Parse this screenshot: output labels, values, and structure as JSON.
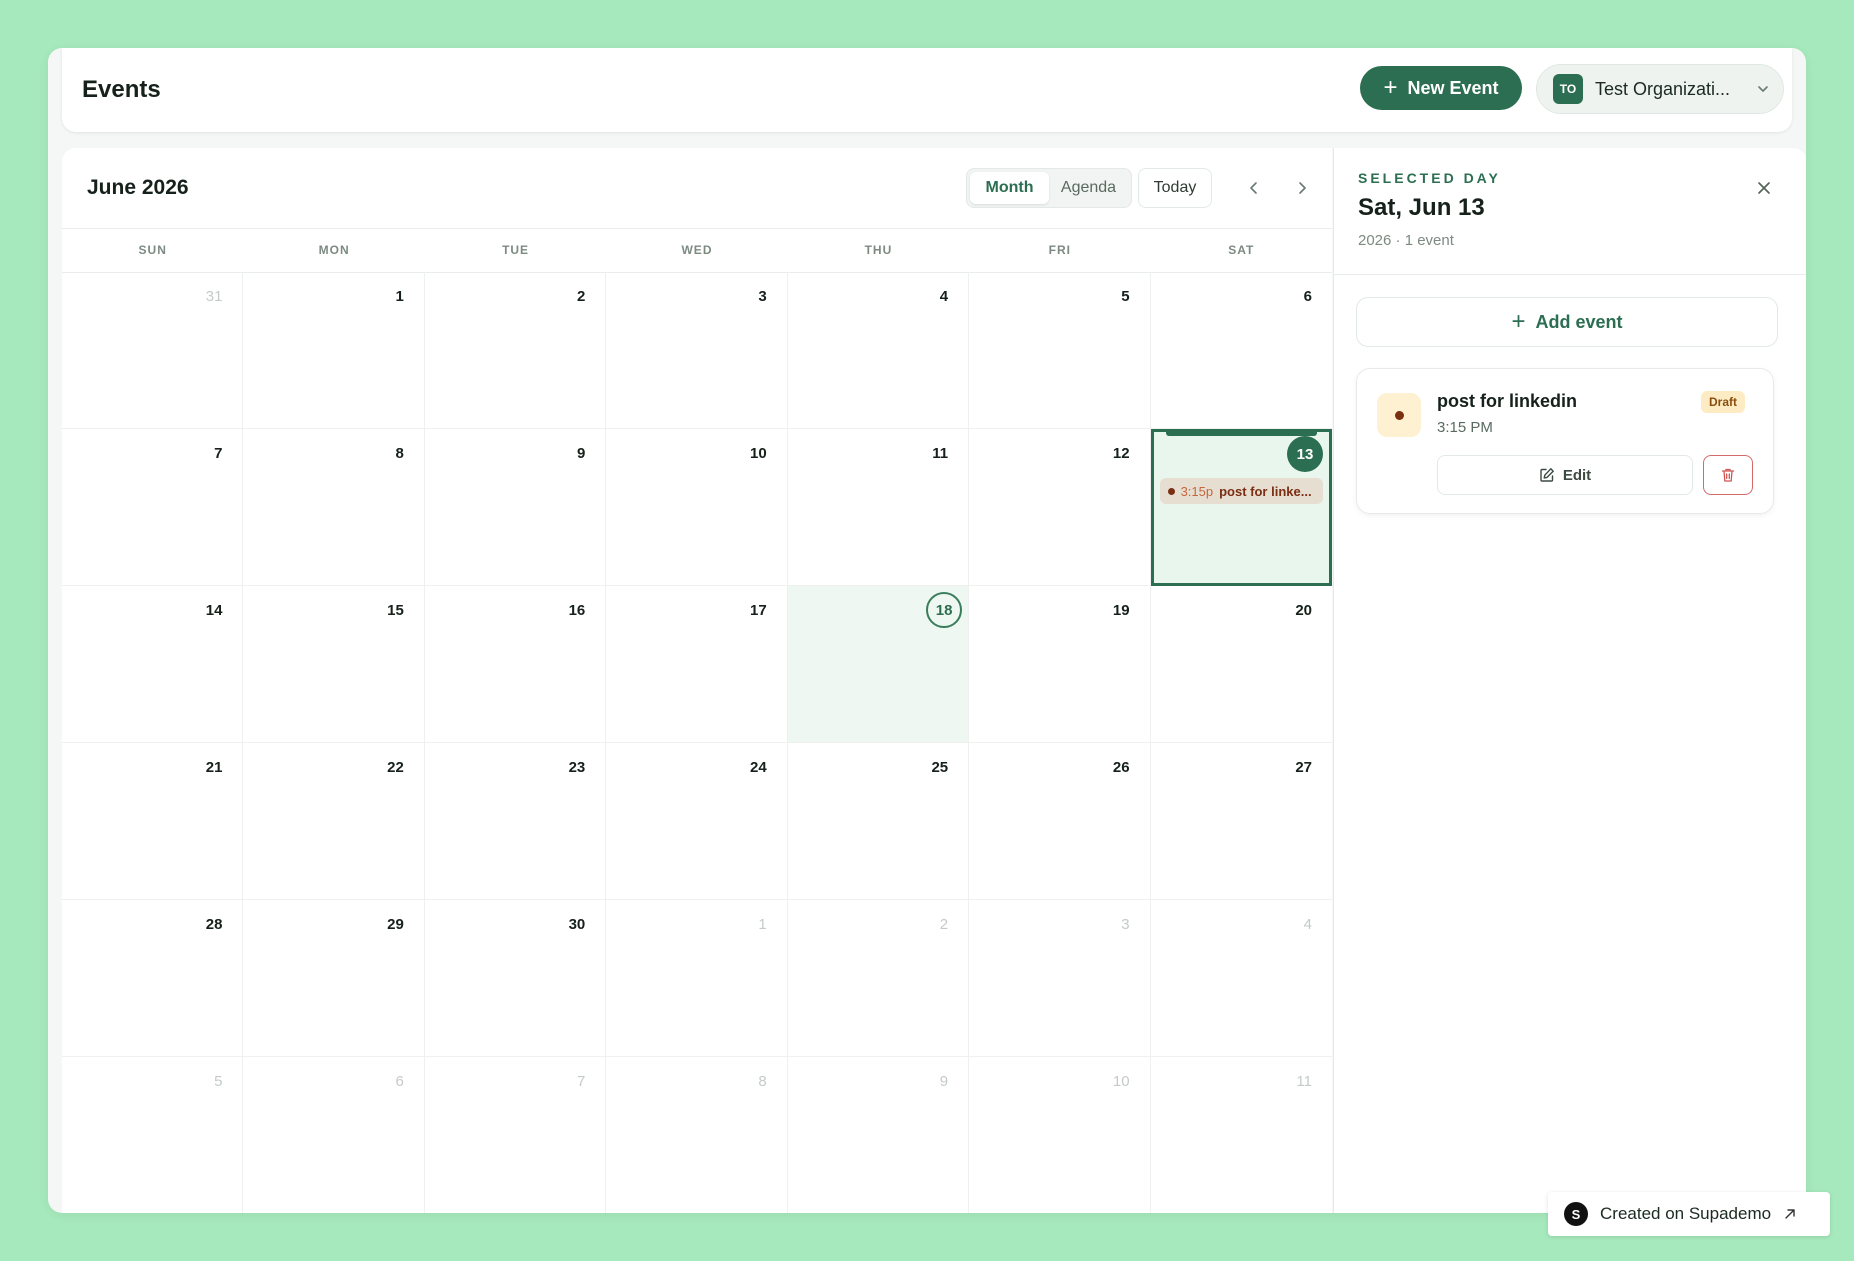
{
  "header": {
    "title": "Events",
    "new_event_label": "New Event",
    "org": {
      "initials": "TO",
      "name": "Test Organizati..."
    }
  },
  "calendar": {
    "month_title": "June 2026",
    "views": [
      "Month",
      "Agenda"
    ],
    "active_view": "Month",
    "today_label": "Today",
    "weekdays": [
      "SUN",
      "MON",
      "TUE",
      "WED",
      "THU",
      "FRI",
      "SAT"
    ],
    "days": [
      {
        "n": "31",
        "outside": true
      },
      {
        "n": "1"
      },
      {
        "n": "2"
      },
      {
        "n": "3"
      },
      {
        "n": "4"
      },
      {
        "n": "5"
      },
      {
        "n": "6"
      },
      {
        "n": "7"
      },
      {
        "n": "8"
      },
      {
        "n": "9"
      },
      {
        "n": "10"
      },
      {
        "n": "11"
      },
      {
        "n": "12"
      },
      {
        "n": "13",
        "selected": true,
        "events": [
          {
            "time": "3:15p",
            "title": "post for linke..."
          }
        ]
      },
      {
        "n": "14"
      },
      {
        "n": "15"
      },
      {
        "n": "16"
      },
      {
        "n": "17"
      },
      {
        "n": "18",
        "today": true
      },
      {
        "n": "19"
      },
      {
        "n": "20"
      },
      {
        "n": "21"
      },
      {
        "n": "22"
      },
      {
        "n": "23"
      },
      {
        "n": "24"
      },
      {
        "n": "25"
      },
      {
        "n": "26"
      },
      {
        "n": "27"
      },
      {
        "n": "28"
      },
      {
        "n": "29"
      },
      {
        "n": "30"
      },
      {
        "n": "1",
        "outside": true
      },
      {
        "n": "2",
        "outside": true
      },
      {
        "n": "3",
        "outside": true
      },
      {
        "n": "4",
        "outside": true
      },
      {
        "n": "5",
        "outside": true
      },
      {
        "n": "6",
        "outside": true
      },
      {
        "n": "7",
        "outside": true
      },
      {
        "n": "8",
        "outside": true
      },
      {
        "n": "9",
        "outside": true
      },
      {
        "n": "10",
        "outside": true
      },
      {
        "n": "11",
        "outside": true
      }
    ]
  },
  "side": {
    "kicker": "SELECTED DAY",
    "title": "Sat, Jun 13",
    "subtitle": "2026 · 1 event",
    "add_event_label": "Add event",
    "event": {
      "title": "post for linkedin",
      "time": "3:15 PM",
      "status": "Draft",
      "edit_label": "Edit"
    }
  },
  "footer": {
    "supademo_logo": "S",
    "supademo_label": "Created on Supademo"
  },
  "colors": {
    "accent": "#2c6e51",
    "background": "#a6e9bc",
    "event": "#7a2e12",
    "draft_badge": "#fdecc3"
  }
}
